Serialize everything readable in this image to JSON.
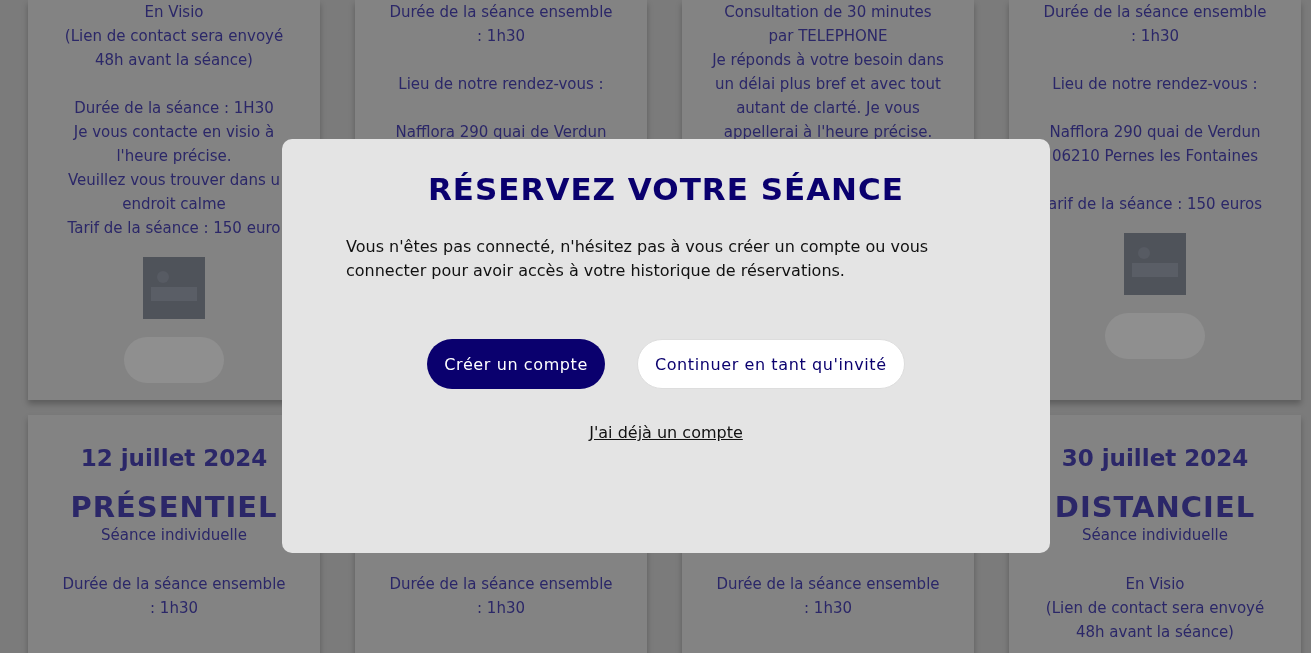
{
  "top_cards": [
    {
      "paragraphs": [
        [
          "En Visio",
          "(Lien de contact sera envoyé",
          "48h avant la séance)"
        ],
        [
          "Durée de la séance : 1H30",
          "Je vous contacte en visio à",
          "l'heure précise.",
          "Veuillez vous trouver dans u",
          "endroit calme",
          "Tarif de la séance : 150 euro"
        ]
      ],
      "image": true,
      "button": true
    },
    {
      "paragraphs": [
        [
          "Durée de la séance ensemble",
          ": 1h30"
        ],
        [
          "Lieu de notre rendez-vous :"
        ],
        [
          "Nafflora 290 quai de Verdun"
        ]
      ]
    },
    {
      "paragraphs": [
        [
          "Consultation de 30 minutes",
          "par TELEPHONE",
          "Je réponds à votre besoin dans",
          "un délai plus bref et avec tout",
          "autant de clarté. Je vous",
          "appellerai à l'heure précise."
        ]
      ]
    },
    {
      "paragraphs": [
        [
          "Durée de la séance ensemble",
          ": 1h30"
        ],
        [
          "Lieu de notre rendez-vous :"
        ],
        [
          "Nafflora 290 quai de Verdun",
          "06210 Pernes les Fontaines"
        ],
        [
          "arif de la séance : 150 euros"
        ]
      ],
      "image": true,
      "button": true
    }
  ],
  "bottom_cards": [
    {
      "date": "12 juillet 2024",
      "mode": "PRÉSENTIEL",
      "subtitle": "Séance individuelle",
      "paragraphs": [
        [
          "Durée de la séance ensemble",
          ": 1h30"
        ]
      ]
    },
    {
      "paragraphs": [
        [
          "Durée de la séance ensemble",
          ": 1h30"
        ]
      ]
    },
    {
      "paragraphs": [
        [
          "Durée de la séance ensemble",
          ": 1h30"
        ]
      ]
    },
    {
      "date": "30 juillet 2024",
      "mode": "DISTANCIEL",
      "subtitle": "Séance individuelle",
      "paragraphs": [
        [
          "En Visio",
          "(Lien de contact sera envoyé",
          "48h avant la séance)"
        ]
      ]
    }
  ],
  "modal": {
    "title": "RÉSERVEZ VOTRE SÉANCE",
    "message": "Vous n'êtes pas connecté, n'hésitez pas à vous créer un compte ou vous connecter pour avoir accès à votre historique de réservations.",
    "buttons": [
      {
        "label": "Créer un compte",
        "kind": "primary"
      },
      {
        "label": "Continuer en tant qu'invité",
        "kind": "secondary"
      }
    ],
    "link": "J'ai déjà un compte"
  }
}
